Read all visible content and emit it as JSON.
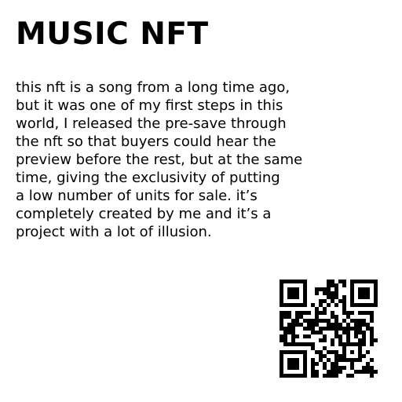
{
  "title": "MUSIC NFT",
  "description_lines": [
    "this nft is a song from a long time ago,",
    "but it was one of my first steps in this",
    "world, I released the pre-save through",
    "the nft so that buyers could hear the",
    "preview before the rest, but at the same",
    "time, giving the exclusivity of putting",
    "a low number of units for sale. it’s",
    "completely created by me and it’s a",
    "project with a lot of illusion."
  ],
  "qr_code": {
    "icon": "qr-code-icon",
    "color": "#000000",
    "background": "#ffffff"
  }
}
